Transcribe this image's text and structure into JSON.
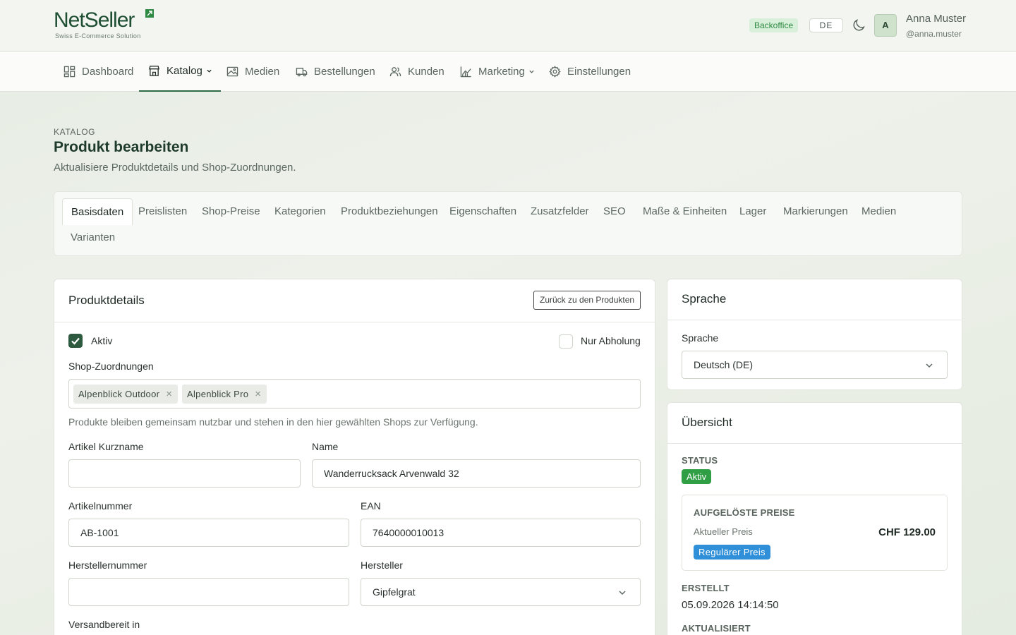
{
  "brand": {
    "name": "NetSeller",
    "tagline": "Swiss E-Commerce Solution"
  },
  "header": {
    "badge": "Backoffice",
    "language": "DE",
    "user": {
      "initial": "A",
      "name": "Anna Muster",
      "handle": "@anna.muster"
    }
  },
  "nav": {
    "items": [
      {
        "label": "Dashboard",
        "icon": "dashboard-icon"
      },
      {
        "label": "Katalog",
        "icon": "store-icon",
        "active": true,
        "dropdown": true
      },
      {
        "label": "Medien",
        "icon": "image-icon"
      },
      {
        "label": "Bestellungen",
        "icon": "truck-icon"
      },
      {
        "label": "Kunden",
        "icon": "users-icon"
      },
      {
        "label": "Marketing",
        "icon": "chart-icon",
        "dropdown": true
      },
      {
        "label": "Einstellungen",
        "icon": "gear-icon"
      }
    ]
  },
  "page": {
    "eyebrow": "KATALOG",
    "title": "Produkt bearbeiten",
    "subtitle": "Aktualisiere Produktdetails und Shop-Zuordnungen."
  },
  "tabs": [
    "Basisdaten",
    "Preislisten",
    "Shop-Preise",
    "Kategorien",
    "Produktbeziehungen",
    "Eigenschaften",
    "Zusatzfelder",
    "SEO",
    "Maße & Einheiten",
    "Lager",
    "Markierungen",
    "Medien",
    "Varianten"
  ],
  "details": {
    "title": "Produktdetails",
    "back_button": "Zurück zu den Produkten",
    "active_label": "Aktiv",
    "active_checked": true,
    "pickup_label": "Nur Abholung",
    "pickup_checked": false,
    "shops_label": "Shop-Zuordnungen",
    "shops": [
      "Alpenblick Outdoor",
      "Alpenblick Pro"
    ],
    "shops_help": "Produkte bleiben gemeinsam nutzbar und stehen in den hier gewählten Shops zur Verfügung.",
    "short_name_label": "Artikel Kurzname",
    "short_name_value": "",
    "name_label": "Name",
    "name_value": "Wanderrucksack Arvenwald 32",
    "article_no_label": "Artikelnummer",
    "article_no_value": "AB-1001",
    "ean_label": "EAN",
    "ean_value": "7640000010013",
    "manufacturer_no_label": "Herstellernummer",
    "manufacturer_no_value": "",
    "manufacturer_label": "Hersteller",
    "manufacturer_value": "Gipfelgrat",
    "shipping_label": "Versandbereit in"
  },
  "language_card": {
    "title": "Sprache",
    "label": "Sprache",
    "value": "Deutsch (DE)"
  },
  "overview": {
    "title": "Übersicht",
    "status_label": "STATUS",
    "status_value": "Aktiv",
    "prices_label": "AUFGELÖSTE PREISE",
    "current_price_label": "Aktueller Preis",
    "current_price_value": "CHF 129.00",
    "price_type": "Regulärer Preis",
    "created_label": "ERSTELLT",
    "created_value": "05.09.2026 14:14:50",
    "updated_label": "AKTUALISIERT"
  },
  "colors": {
    "brand_green": "#1e4f33",
    "status_green": "#2f9e44",
    "price_blue": "#2f8fd8"
  }
}
